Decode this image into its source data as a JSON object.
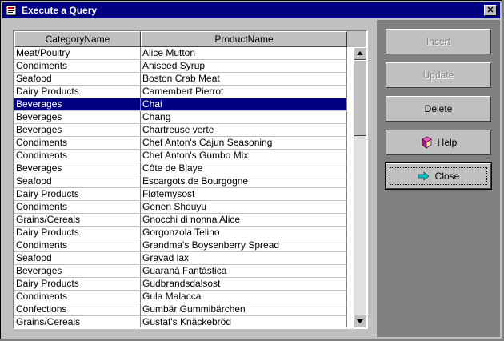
{
  "window": {
    "title": "Execute a Query"
  },
  "grid": {
    "columns": [
      "CategoryName",
      "ProductName"
    ],
    "selected_index": 4,
    "rows": [
      [
        "Meat/Poultry",
        "Alice Mutton"
      ],
      [
        "Condiments",
        "Aniseed Syrup"
      ],
      [
        "Seafood",
        "Boston Crab Meat"
      ],
      [
        "Dairy Products",
        "Camembert Pierrot"
      ],
      [
        "Beverages",
        "Chai"
      ],
      [
        "Beverages",
        "Chang"
      ],
      [
        "Beverages",
        "Chartreuse verte"
      ],
      [
        "Condiments",
        "Chef Anton's Cajun Seasoning"
      ],
      [
        "Condiments",
        "Chef Anton's Gumbo Mix"
      ],
      [
        "Beverages",
        "Côte de Blaye"
      ],
      [
        "Seafood",
        "Escargots de Bourgogne"
      ],
      [
        "Dairy Products",
        "Fløtemysost"
      ],
      [
        "Condiments",
        "Genen Shouyu"
      ],
      [
        "Grains/Cereals",
        "Gnocchi di nonna Alice"
      ],
      [
        "Dairy Products",
        "Gorgonzola Telino"
      ],
      [
        "Condiments",
        "Grandma's Boysenberry Spread"
      ],
      [
        "Seafood",
        "Gravad lax"
      ],
      [
        "Beverages",
        "Guaraná Fantástica"
      ],
      [
        "Dairy Products",
        "Gudbrandsdalsost"
      ],
      [
        "Condiments",
        "Gula Malacca"
      ],
      [
        "Confections",
        "Gumbär Gummibärchen"
      ],
      [
        "Grains/Cereals",
        "Gustaf's Knäckebröd"
      ]
    ]
  },
  "buttons": {
    "insert": {
      "label": "Insert",
      "enabled": false
    },
    "update": {
      "label": "Update",
      "enabled": false
    },
    "delete": {
      "label": "Delete",
      "enabled": true
    },
    "help": {
      "label": "Help",
      "icon": "help-book-icon"
    },
    "close": {
      "label": "Close",
      "icon": "arrow-right-icon"
    }
  },
  "colors": {
    "title_bar": "#000080",
    "selection": "#000080",
    "panel": "#808080",
    "face": "#c0c0c0"
  }
}
